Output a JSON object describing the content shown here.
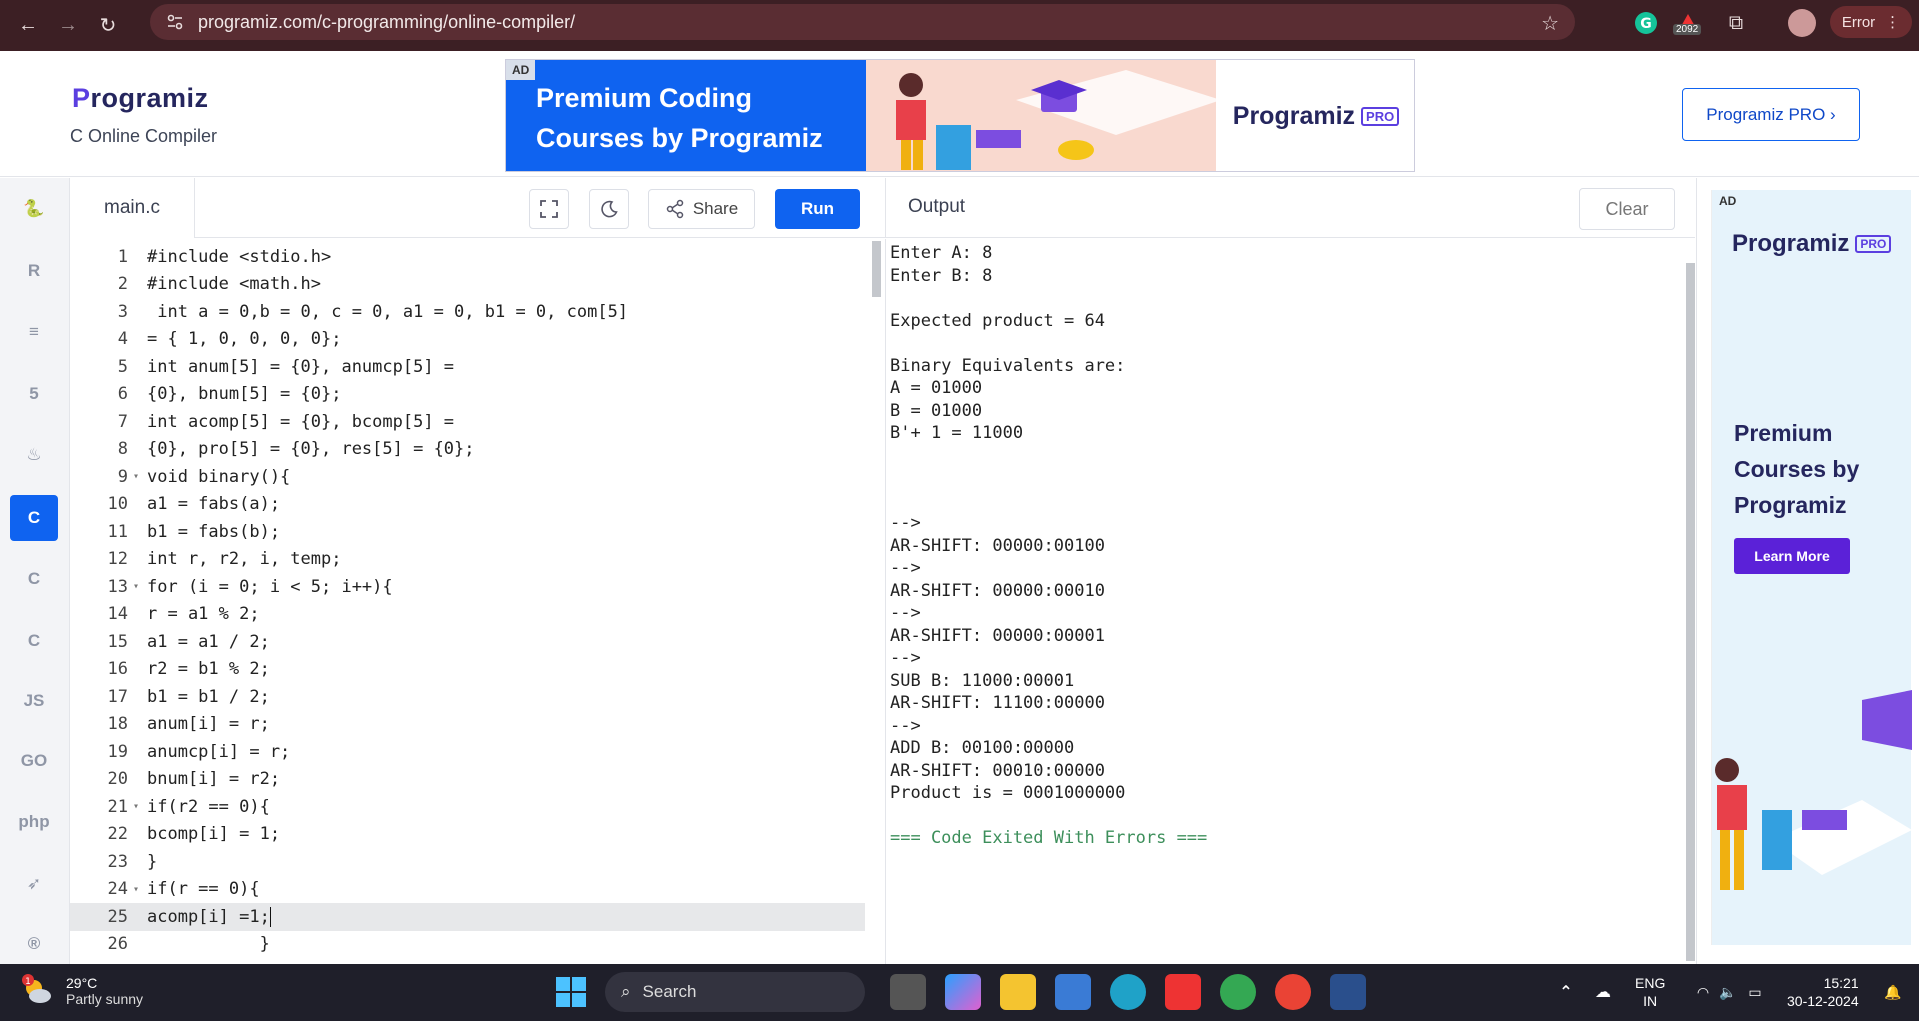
{
  "browser": {
    "url": "programiz.com/c-programming/online-compiler/",
    "extension_badge": "2092",
    "profile_status": "Error"
  },
  "header": {
    "logo_text": "rogramiz",
    "logo_letter": "P",
    "subtitle": "C Online Compiler",
    "pro_button": "Programiz PRO ›",
    "banner": {
      "ad_tag": "AD",
      "headline": "Premium Coding Courses by Programiz",
      "brand": "Programiz",
      "pro_tag": "PRO"
    }
  },
  "sidebar": {
    "items": [
      {
        "icon": "python-icon",
        "glyph": "🐍",
        "active": false
      },
      {
        "icon": "r-icon",
        "glyph": "R",
        "active": false
      },
      {
        "icon": "sql-icon",
        "glyph": "≡",
        "active": false
      },
      {
        "icon": "html-icon",
        "glyph": "5",
        "active": false
      },
      {
        "icon": "java-icon",
        "glyph": "♨",
        "active": false
      },
      {
        "icon": "c-icon",
        "glyph": "C",
        "active": true
      },
      {
        "icon": "cpp-icon",
        "glyph": "C",
        "active": false
      },
      {
        "icon": "csharp-icon",
        "glyph": "C",
        "active": false
      },
      {
        "icon": "js-icon",
        "glyph": "JS",
        "active": false
      },
      {
        "icon": "go-icon",
        "glyph": "GO",
        "active": false
      },
      {
        "icon": "php-icon",
        "glyph": "php",
        "active": false
      },
      {
        "icon": "swift-icon",
        "glyph": "➶",
        "active": false
      },
      {
        "icon": "rust-icon",
        "glyph": "®",
        "active": false
      }
    ]
  },
  "editor": {
    "filename": "main.c",
    "share_label": "Share",
    "run_label": "Run",
    "current_line": 25,
    "lines": [
      {
        "n": "1",
        "fold": "",
        "text": "#include <stdio.h>"
      },
      {
        "n": "2",
        "fold": "",
        "text": "#include <math.h>"
      },
      {
        "n": "3",
        "fold": "",
        "text": " int a = 0,b = 0, c = 0, a1 = 0, b1 = 0, com[5]"
      },
      {
        "n": "4",
        "fold": "",
        "text": "= { 1, 0, 0, 0, 0};"
      },
      {
        "n": "5",
        "fold": "",
        "text": "int anum[5] = {0}, anumcp[5] ="
      },
      {
        "n": "6",
        "fold": "",
        "text": "{0}, bnum[5] = {0};"
      },
      {
        "n": "7",
        "fold": "",
        "text": "int acomp[5] = {0}, bcomp[5] ="
      },
      {
        "n": "8",
        "fold": "",
        "text": "{0}, pro[5] = {0}, res[5] = {0};"
      },
      {
        "n": "9",
        "fold": "▾",
        "text": "void binary(){"
      },
      {
        "n": "10",
        "fold": "",
        "text": "a1 = fabs(a);"
      },
      {
        "n": "11",
        "fold": "",
        "text": "b1 = fabs(b);"
      },
      {
        "n": "12",
        "fold": "",
        "text": "int r, r2, i, temp;"
      },
      {
        "n": "13",
        "fold": "▾",
        "text": "for (i = 0; i < 5; i++){"
      },
      {
        "n": "14",
        "fold": "",
        "text": "r = a1 % 2;"
      },
      {
        "n": "15",
        "fold": "",
        "text": "a1 = a1 / 2;"
      },
      {
        "n": "16",
        "fold": "",
        "text": "r2 = b1 % 2;"
      },
      {
        "n": "17",
        "fold": "",
        "text": "b1 = b1 / 2;"
      },
      {
        "n": "18",
        "fold": "",
        "text": "anum[i] = r;"
      },
      {
        "n": "19",
        "fold": "",
        "text": "anumcp[i] = r;"
      },
      {
        "n": "20",
        "fold": "",
        "text": "bnum[i] = r2;"
      },
      {
        "n": "21",
        "fold": "▾",
        "text": "if(r2 == 0){"
      },
      {
        "n": "22",
        "fold": "",
        "text": "bcomp[i] = 1;"
      },
      {
        "n": "23",
        "fold": "",
        "text": "}"
      },
      {
        "n": "24",
        "fold": "▾",
        "text": "if(r == 0){"
      },
      {
        "n": "25",
        "fold": "",
        "text": "acomp[i] =1;"
      },
      {
        "n": "26",
        "fold": "",
        "text": "           }"
      }
    ]
  },
  "output": {
    "title": "Output",
    "clear_label": "Clear",
    "lines": [
      "Enter A: 8",
      "Enter B: 8",
      "",
      "Expected product = 64",
      "",
      "Binary Equivalents are:",
      "A = 01000",
      "B = 01000",
      "B'+ 1 = 11000",
      "",
      "",
      "",
      "-->",
      "AR-SHIFT: 00000:00100",
      "-->",
      "AR-SHIFT: 00000:00010",
      "-->",
      "AR-SHIFT: 00000:00001",
      "-->",
      "SUB B: 11000:00001",
      "AR-SHIFT: 11100:00000",
      "-->",
      "ADD B: 00100:00000",
      "AR-SHIFT: 00010:00000",
      "Product is = 0001000000",
      "",
      "=== Code Exited With Errors ==="
    ]
  },
  "side_ad": {
    "ad_tag": "AD",
    "brand": "Programiz",
    "pro_tag": "PRO",
    "headline": "Premium Courses by Programiz",
    "cta": "Learn More"
  },
  "taskbar": {
    "weather_badge": "1",
    "temperature": "29°C",
    "condition": "Partly sunny",
    "search_label": "Search",
    "lang_line1": "ENG",
    "lang_line2": "IN",
    "time": "15:21",
    "date": "30-12-2024"
  },
  "colors": {
    "accent": "#0f63f0",
    "chrome_bg": "#3c1f24",
    "status_green": "#3d8f5b"
  }
}
